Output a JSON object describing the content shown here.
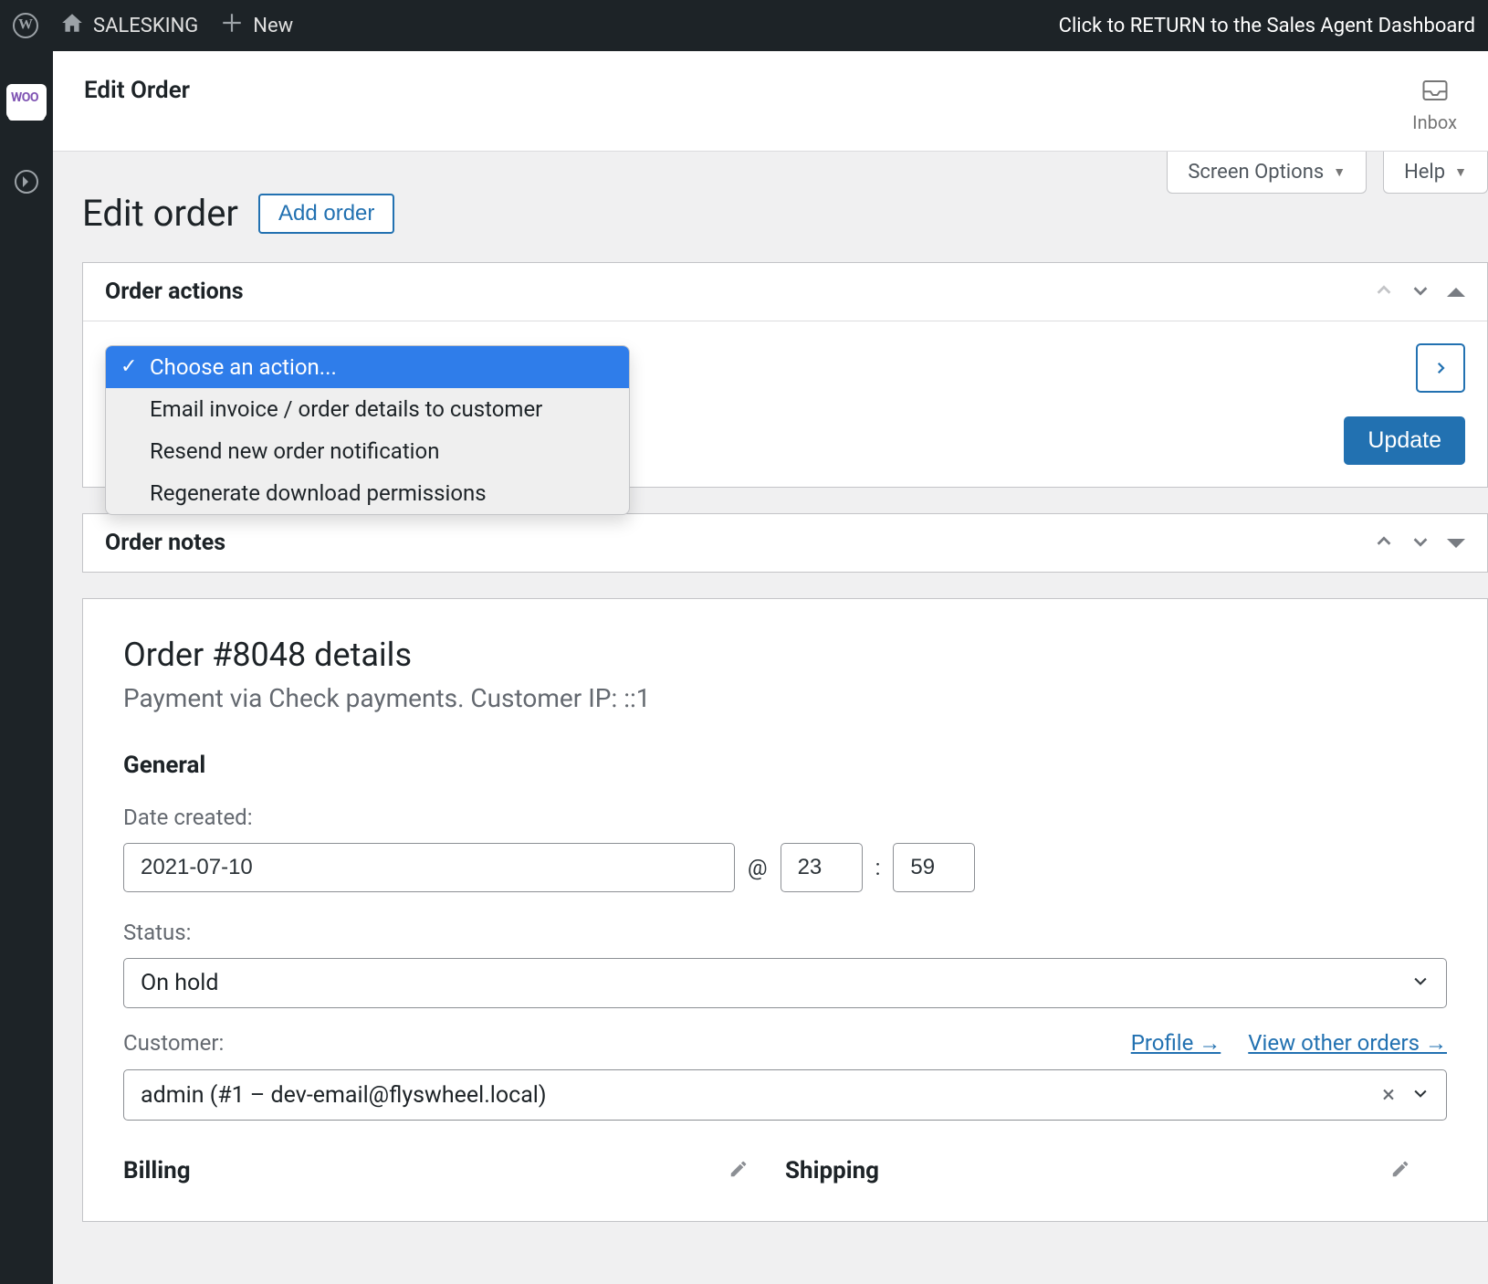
{
  "adminbar": {
    "site_name": "SALESKING",
    "new_label": "New",
    "return_text": "Click to RETURN to the Sales Agent Dashboard"
  },
  "leftrail": {
    "woo_label": "WOO"
  },
  "topbar": {
    "title": "Edit Order",
    "inbox_label": "Inbox"
  },
  "tabs": {
    "screen_options": "Screen Options",
    "help": "Help"
  },
  "page": {
    "heading": "Edit order",
    "add_order": "Add order"
  },
  "order_actions": {
    "title": "Order actions",
    "options": [
      "Choose an action...",
      "Email invoice / order details to customer",
      "Resend new order notification",
      "Regenerate download permissions"
    ],
    "update_label": "Update"
  },
  "order_notes": {
    "title": "Order notes"
  },
  "details": {
    "order_title": "Order #8048 details",
    "payment_line": "Payment via Check payments. Customer IP: ::1",
    "general_heading": "General",
    "date_label": "Date created:",
    "date_value": "2021-07-10",
    "at": "@",
    "hour": "23",
    "colon": ":",
    "minute": "59",
    "status_label": "Status:",
    "status_value": "On hold",
    "customer_label": "Customer:",
    "profile_link": "Profile →",
    "other_orders_link": "View other orders →",
    "customer_value": "admin (#1 – dev-email@flyswheel.local)",
    "clear_x": "×",
    "billing_heading": "Billing",
    "shipping_heading": "Shipping"
  }
}
